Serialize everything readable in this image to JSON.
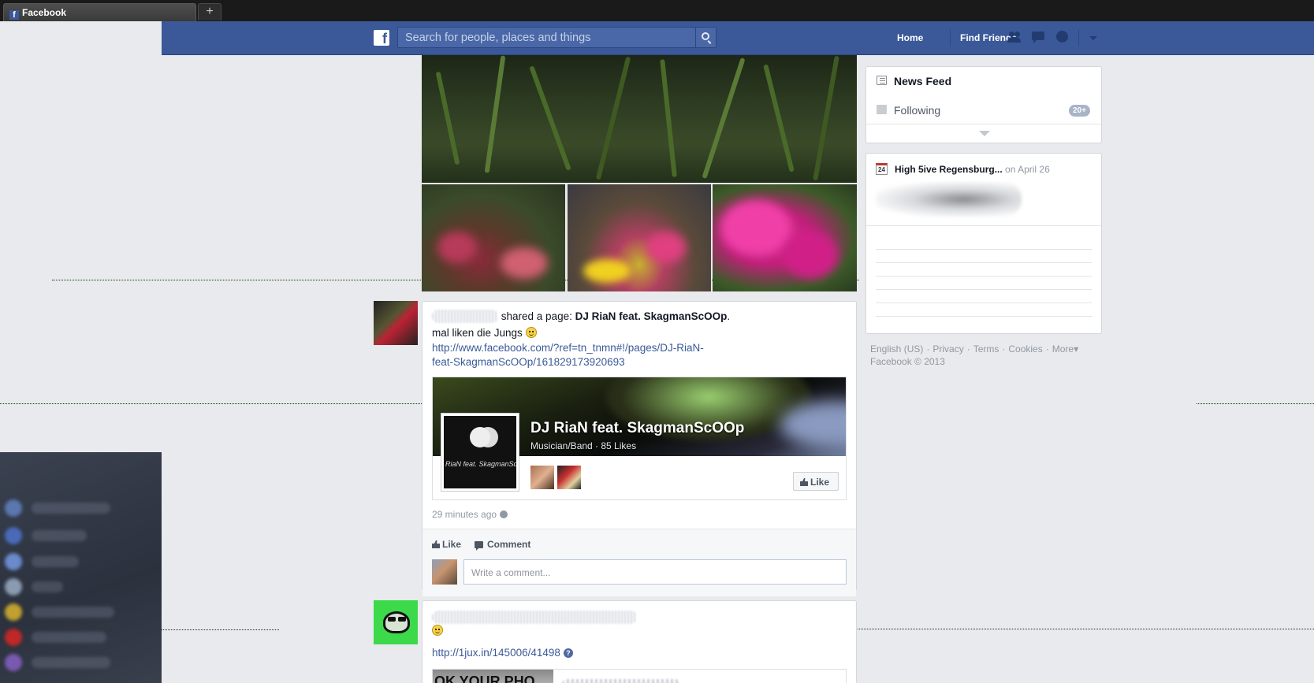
{
  "browser": {
    "tab_title": "Facebook",
    "new_tab_label": "+"
  },
  "header": {
    "logo_letter": "f",
    "search_placeholder": "Search for people, places and things",
    "home_label": "Home",
    "find_friends_label": "Find Friends"
  },
  "post1": {
    "shared_text": "shared a page:",
    "page_link": "DJ RiaN feat. SkagmanScOOp",
    "period": ".",
    "message": "mal liken die Jungs",
    "url_line1": "http://www.facebook.com/?ref=tn_tnmn#!/pages/DJ-RiaN-",
    "url_line2": "feat-SkagmanScOOp/161829173920693",
    "share": {
      "name": "DJ RiaN feat. SkagmanScOOp",
      "meta": "Musician/Band · 85 Likes",
      "pic_text": "RiaN feat. SkagmanSc",
      "like_button": "Like"
    },
    "timestamp": "29 minutes ago",
    "actions": {
      "like": "Like",
      "comment": "Comment"
    },
    "comment_placeholder": "Write a comment..."
  },
  "post2": {
    "url": "http://1jux.in/145006/41498",
    "question_mark": "?",
    "preview_image_text": "OK YOUR PHO"
  },
  "sidebar": {
    "nav": [
      {
        "label": "News Feed"
      },
      {
        "label": "Following",
        "badge": "20+"
      }
    ],
    "event": {
      "day": "24",
      "title": "High 5ive Regensburg...",
      "date": "on April 26"
    }
  },
  "footer": {
    "links": [
      "English (US)",
      "Privacy",
      "Terms",
      "Cookies",
      "More"
    ],
    "more_caret": "▾",
    "copyright": "Facebook © 2013"
  },
  "colors": {
    "brand_blue": "#3b5998",
    "page_bg": "#e9eaed",
    "link": "#3b5998",
    "muted": "#9197a3"
  }
}
